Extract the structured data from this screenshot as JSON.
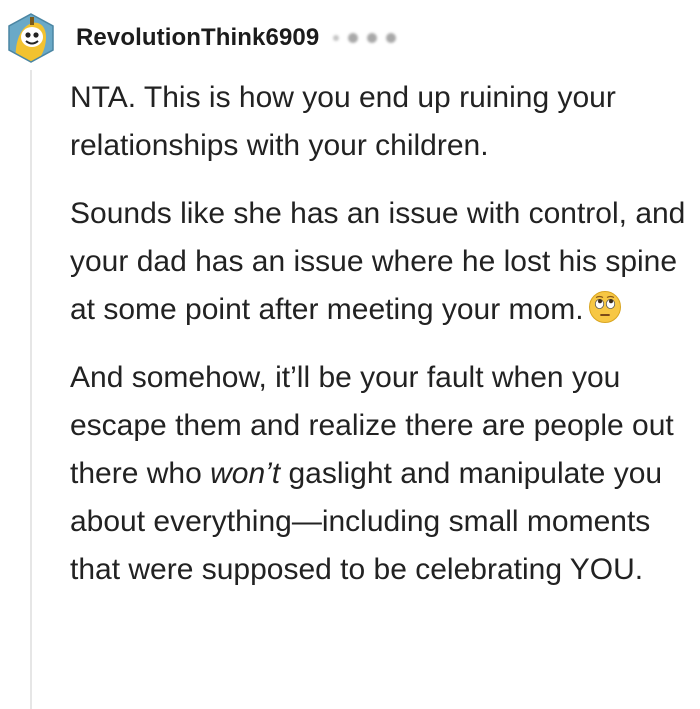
{
  "comment": {
    "author": "RevolutionThink6909",
    "avatar_icon": "banana-snoo-avatar",
    "badge_icons": [
      "award-icon",
      "award-icon",
      "award-icon",
      "award-icon"
    ],
    "paragraphs": {
      "p1": "NTA. This is how you end up ruining your relationships with your children.",
      "p2": "Sounds like she has an issue with control, and your dad has an issue where he lost his spine at some point after meeting your mom.",
      "p3_before": "And somehow, it’ll be your fault when you escape them and realize there are people out there who ",
      "p3_emph": "won’t",
      "p3_after": " gaslight and manipulate you about everything—including small moments that were supposed to be celebrating YOU."
    },
    "emoji": "face-with-rolling-eyes-icon"
  },
  "colors": {
    "text": "#222222",
    "thread_line": "#e6e6e6",
    "avatar_bg": "#6aa9c7",
    "banana": "#f2c230"
  }
}
